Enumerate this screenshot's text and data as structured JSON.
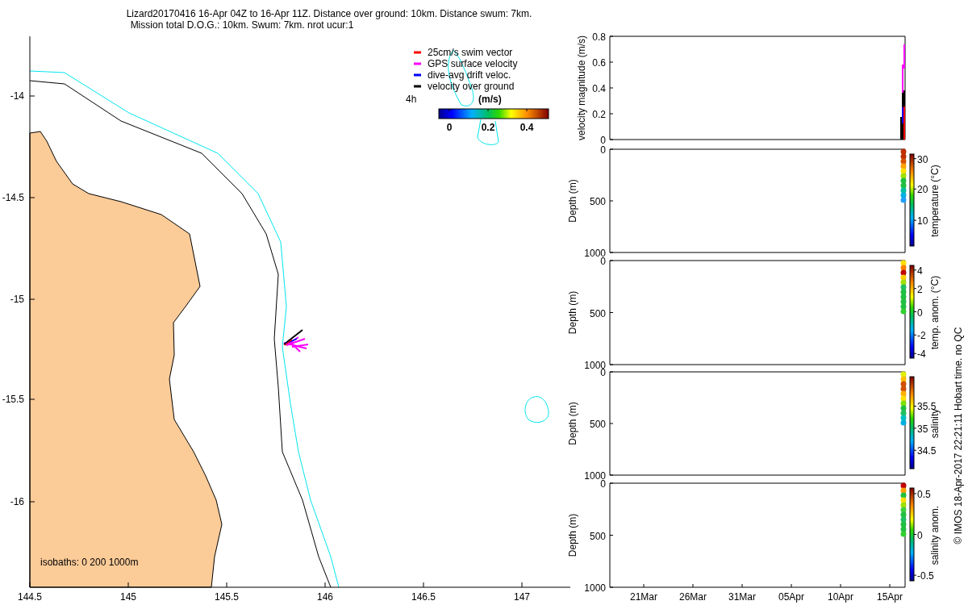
{
  "title_lines": [
    "Lizard20170416 16-Apr 04Z to 16-Apr 11Z. Distance over ground: 10km. Distance swum: 7km.",
    "Mission total D.O.G.: 10km. Swum: 7km. nrot ucur:1"
  ],
  "map": {
    "yticks": [
      "-14",
      "-14.5",
      "-15",
      "-15.5",
      "-16"
    ],
    "xticks": [
      "144.5",
      "145",
      "145.5",
      "146",
      "146.5",
      "147"
    ],
    "legend": [
      {
        "label": "25cm/s swim vector",
        "color": "#ff0000"
      },
      {
        "label": "GPS surface velocity",
        "color": "#ff00ff"
      },
      {
        "label": "dive-avg drift veloc.",
        "color": "#0000ff"
      },
      {
        "label": "velocity over ground",
        "color": "#000000"
      }
    ],
    "interval": "4h",
    "colorbar_label": "(m/s)",
    "colorbar_ticks": [
      "0",
      "0.2",
      "0.4"
    ],
    "isobaths_note": "isobaths: 0   200  1000m"
  },
  "panels": [
    {
      "kind": "velocity",
      "ylabel": "velocity magnitude (m/s)",
      "yticks": [
        "0.8",
        "0.6",
        "0.4",
        "0.2",
        "0"
      ]
    },
    {
      "kind": "profile",
      "ylabel": "Depth (m)",
      "yticks": [
        "0",
        "500",
        "1000"
      ],
      "colorbar_label": "temperature (°C)",
      "colorbar_ticks": [
        "30",
        "20",
        "10"
      ]
    },
    {
      "kind": "profile",
      "ylabel": "Depth (m)",
      "yticks": [
        "0",
        "500",
        "1000"
      ],
      "colorbar_label": "temp. anom. (°C)",
      "colorbar_ticks": [
        "4",
        "2",
        "0",
        "-2",
        "-4"
      ]
    },
    {
      "kind": "profile",
      "ylabel": "Depth (m)",
      "yticks": [
        "0",
        "500",
        "1000"
      ],
      "colorbar_label": "salinity",
      "colorbar_ticks": [
        "35.5",
        "35",
        "34.5"
      ]
    },
    {
      "kind": "profile",
      "ylabel": "Depth (m)",
      "yticks": [
        "0",
        "500",
        "1000"
      ],
      "colorbar_label": "salinity anom.",
      "colorbar_ticks": [
        "0.5",
        "0",
        "-0.5"
      ]
    }
  ],
  "time_ticks": [
    "21Mar",
    "26Mar",
    "31Mar",
    "05Apr",
    "10Apr",
    "15Apr"
  ],
  "footer": "© IMOS 18-Apr-2017 22:21:11 Hobart time. no QC"
}
